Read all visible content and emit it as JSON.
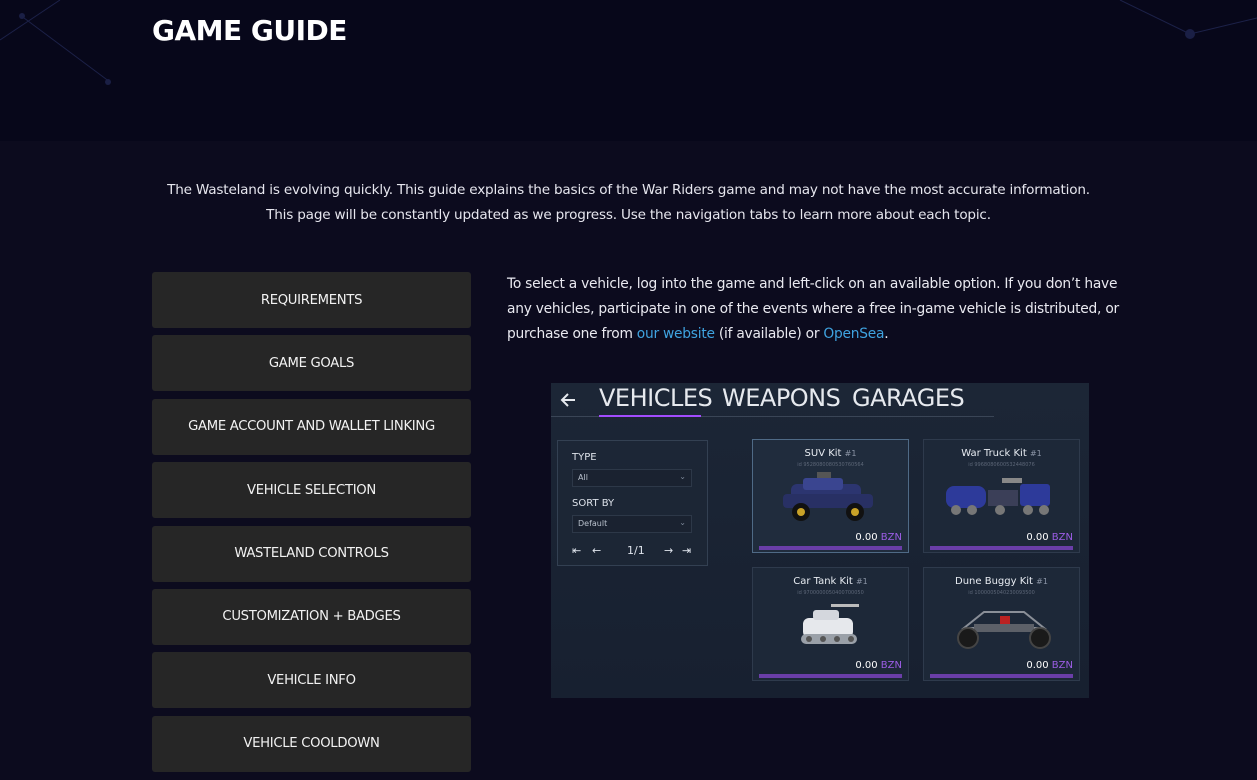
{
  "header": {
    "title": "GAME GUIDE"
  },
  "intro": {
    "line1": "The Wasteland is evolving quickly. This guide explains the basics of the War Riders game and may not have the most accurate information.",
    "line2": "This page will be constantly updated as we progress. Use the navigation tabs to learn more about each topic."
  },
  "nav": {
    "items": [
      {
        "label": "REQUIREMENTS"
      },
      {
        "label": "GAME GOALS"
      },
      {
        "label": "GAME ACCOUNT AND WALLET LINKING"
      },
      {
        "label": "VEHICLE SELECTION"
      },
      {
        "label": "WASTELAND CONTROLS"
      },
      {
        "label": "CUSTOMIZATION + BADGES"
      },
      {
        "label": "VEHICLE INFO"
      },
      {
        "label": "VEHICLE COOLDOWN"
      }
    ]
  },
  "content": {
    "text_before": "To select a vehicle, log into the game and left-click on an available option. If you don’t have any vehicles, participate in one of the events where a free in-game vehicle is distributed, or purchase one from ",
    "link_website": "our website",
    "text_middle": " (if available) or ",
    "link_opensea": "OpenSea",
    "text_after": "."
  },
  "screenshot": {
    "back_icon": "arrow-left-icon",
    "tabs": [
      "VEHICLES",
      "WEAPONS",
      "GARAGES"
    ],
    "filter": {
      "type_label": "TYPE",
      "type_value": "All",
      "sort_label": "SORT BY",
      "sort_value": "Default",
      "page": "1/1"
    },
    "cards": [
      {
        "name": "SUV Kit",
        "num": "#1",
        "id": "id 9528080080530760564",
        "price": "0.00",
        "currency": "BZN"
      },
      {
        "name": "War Truck Kit",
        "num": "#1",
        "id": "id 9968080600532448076",
        "price": "0.00",
        "currency": "BZN"
      },
      {
        "name": "Car Tank Kit",
        "num": "#1",
        "id": "id 9700000050400700050",
        "price": "0.00",
        "currency": "BZN"
      },
      {
        "name": "Dune Buggy Kit",
        "num": "#1",
        "id": "id 1000005040230093500",
        "price": "0.00",
        "currency": "BZN"
      }
    ]
  },
  "colors": {
    "background": "#0c0b1e",
    "header_bg": "#07071a",
    "nav_bg": "#262626",
    "link": "#3fa3e0",
    "accent_purple": "#a24cff"
  }
}
